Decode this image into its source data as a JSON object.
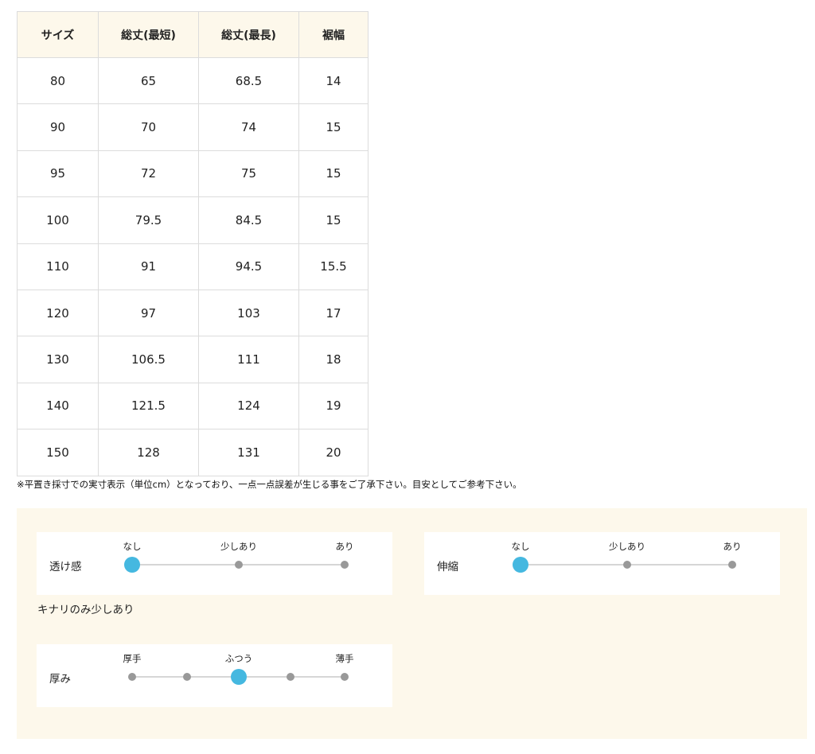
{
  "size_table": {
    "headers": [
      "サイズ",
      "総丈(最短)",
      "総丈(最長)",
      "裾幅"
    ],
    "rows": [
      [
        "80",
        "65",
        "68.5",
        "14"
      ],
      [
        "90",
        "70",
        "74",
        "15"
      ],
      [
        "95",
        "72",
        "75",
        "15"
      ],
      [
        "100",
        "79.5",
        "84.5",
        "15"
      ],
      [
        "110",
        "91",
        "94.5",
        "15.5"
      ],
      [
        "120",
        "97",
        "103",
        "17"
      ],
      [
        "130",
        "106.5",
        "111",
        "18"
      ],
      [
        "140",
        "121.5",
        "124",
        "19"
      ],
      [
        "150",
        "128",
        "131",
        "20"
      ]
    ]
  },
  "note": "※平置き採寸での実寸表示（単位cm）となっており、一点一点誤差が生じる事をご了承下さい。目安としてご参考下さい。",
  "attributes": {
    "transparency": {
      "label": "透け感",
      "scale": [
        "なし",
        "少しあり",
        "あり"
      ],
      "points": 3,
      "selected_index": 0,
      "note": "キナリのみ少しあり"
    },
    "stretch": {
      "label": "伸縮",
      "scale": [
        "なし",
        "少しあり",
        "あり"
      ],
      "points": 3,
      "selected_index": 0
    },
    "thickness": {
      "label": "厚み",
      "scale": [
        "厚手",
        "ふつう",
        "薄手"
      ],
      "points": 5,
      "selected_index": 2
    }
  },
  "colors": {
    "header_bg": "#fdf8eb",
    "panel_bg": "#fdf8eb",
    "active_dot": "#45b8e0",
    "inactive_dot": "#999999",
    "border": "#dcdcdc"
  }
}
